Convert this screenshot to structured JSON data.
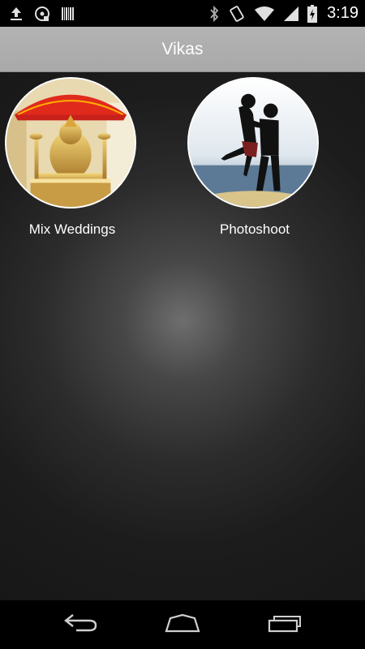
{
  "status_bar": {
    "time": "3:19",
    "left_icons": [
      "upload-icon",
      "sdcard-icon",
      "barcode-icon"
    ],
    "right_icons": [
      "bluetooth-icon",
      "vibrate-icon",
      "wifi-icon",
      "cellular-signal-icon",
      "battery-icon"
    ]
  },
  "action_bar": {
    "title": "Vikas"
  },
  "albums": [
    {
      "label": "Mix Weddings",
      "icon": "ganesha-idol-thumbnail"
    },
    {
      "label": "Photoshoot",
      "icon": "couple-silhouette-thumbnail"
    }
  ],
  "nav_bar": {
    "buttons": [
      "back-icon",
      "home-icon",
      "recents-icon"
    ]
  },
  "colors": {
    "action_bar": "#aaaaaa",
    "background_center": "#6e6e6e",
    "background_edge": "#1c1c1c",
    "text": "#ffffff"
  }
}
